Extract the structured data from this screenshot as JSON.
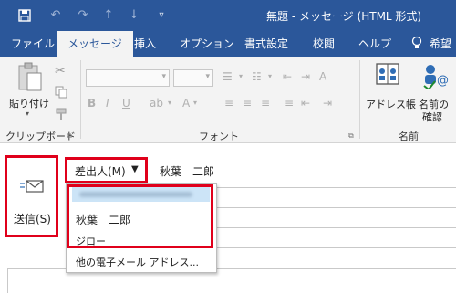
{
  "window": {
    "title": "無題 - メッセージ (HTML 形式)",
    "quick_access": [
      "save-icon",
      "undo-icon",
      "redo-icon",
      "up-arrow-icon",
      "down-arrow-icon",
      "customize-icon"
    ]
  },
  "tabs": {
    "file": "ファイル",
    "message": "メッセージ",
    "insert": "挿入",
    "options": "オプション",
    "format_text": "書式設定",
    "review": "校閲",
    "help": "ヘルプ",
    "tell_me": "希望"
  },
  "ribbon": {
    "clipboard": {
      "paste_label": "貼り付け",
      "group_label": "クリップボード"
    },
    "font": {
      "group_label": "フォント"
    },
    "names": {
      "address_book": "アドレス帳",
      "check_names_line1": "名前の",
      "check_names_line2": "確認",
      "group_label": "名前"
    }
  },
  "compose": {
    "send_label": "送信(S)",
    "from_button": "差出人(M)",
    "from_value": "秋葉　二郎",
    "from_dropdown": {
      "items": [
        {
          "label": "",
          "blurred": true
        },
        {
          "label": "秋葉　二郎"
        },
        {
          "label": "ジロー"
        }
      ],
      "other_label": "他の電子メール アドレス..."
    }
  },
  "colors": {
    "ribbon_blue": "#2b579a",
    "highlight": "#e0001b",
    "selected_item": "#cce4f7"
  }
}
